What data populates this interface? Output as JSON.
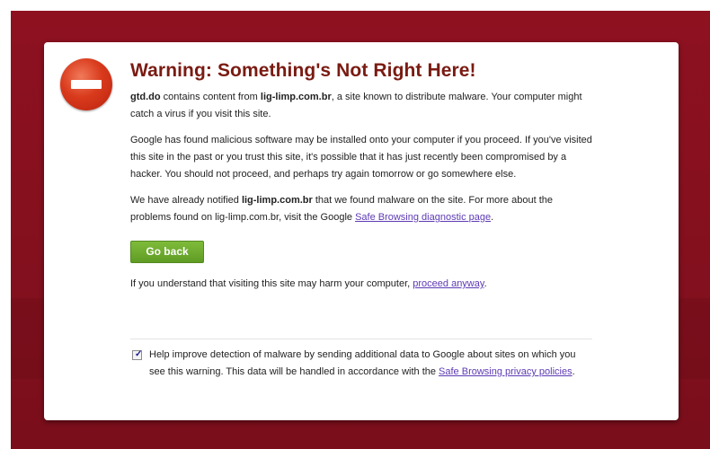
{
  "title": "Warning: Something's Not Right Here!",
  "para1": {
    "site": "gtd.do",
    "t1": " contains content from ",
    "bad_site": "lig-limp.com.br",
    "t2": ", a site known to distribute malware. Your computer might catch a virus if you visit this site."
  },
  "para2": "Google has found malicious software may be installed onto your computer if you proceed. If you've visited this site in the past or you trust this site, it's possible that it has just recently been compromised by a hacker. You should not proceed, and perhaps try again tomorrow or go somewhere else.",
  "para3": {
    "t1": "We have already notified ",
    "bad_site": "lig-limp.com.br",
    "t2": " that we found malware on the site. For more about the problems found on lig-limp.com.br, visit the Google ",
    "link": "Safe Browsing diagnostic page",
    "t3": "."
  },
  "go_back_label": "Go back",
  "proceed": {
    "t1": "If you understand that visiting this site may harm your computer, ",
    "link": "proceed anyway",
    "t2": "."
  },
  "improve": {
    "checked": true,
    "t1": "Help improve detection of malware by sending additional data to Google about sites on which you see this warning. This data will be handled in accordance with the ",
    "link": "Safe Browsing privacy policies",
    "t2": "."
  },
  "colors": {
    "background": "#8e1120",
    "title": "#7a1b12",
    "link": "#5d3ab4",
    "button": "#6aa82c",
    "stop_icon": "#d93a1c"
  },
  "icons": [
    "stop-icon",
    "checkmark-icon"
  ]
}
